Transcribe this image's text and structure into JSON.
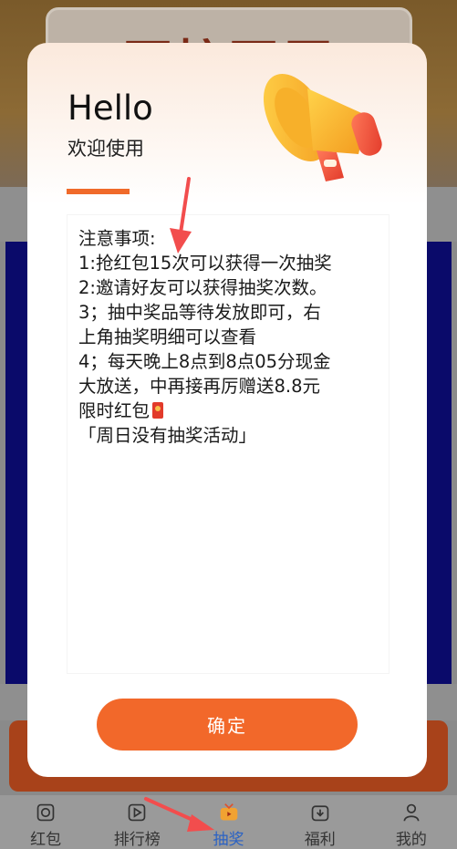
{
  "background": {
    "banner_text": "再接再厉"
  },
  "modal": {
    "title": "Hello",
    "subtitle": "欢迎使用",
    "notice_lines": [
      "注意事项:",
      "1:抢红包15次可以获得一次抽奖",
      "2:邀请好友可以获得抽奖次数。",
      "3；抽中奖品等待发放即可，右",
      "上角抽奖明细可以查看",
      "4；每天晚上8点到8点05分现金",
      "大放送，中再接再厉赠送8.8元",
      "限时红包",
      "「周日没有抽奖活动」"
    ],
    "confirm_label": "确定"
  },
  "tabbar": {
    "items": [
      {
        "label": "红包",
        "icon": "red-packet-icon"
      },
      {
        "label": "排行榜",
        "icon": "play-icon"
      },
      {
        "label": "抽奖",
        "icon": "tv-icon",
        "active": true
      },
      {
        "label": "福利",
        "icon": "gift-icon"
      },
      {
        "label": "我的",
        "icon": "person-icon"
      }
    ]
  },
  "colors": {
    "accent": "#f2682a",
    "active_tab": "#2a62c4",
    "arrow": "#f24d4d"
  }
}
